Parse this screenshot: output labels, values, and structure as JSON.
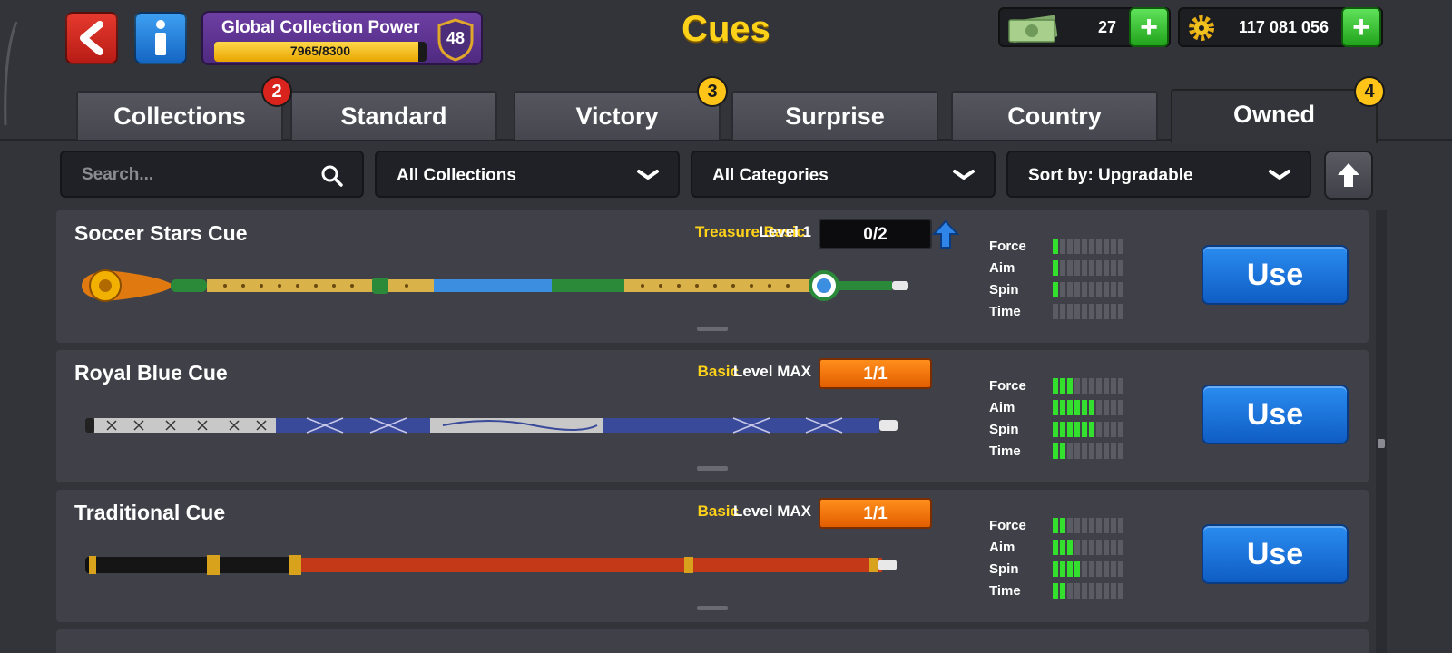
{
  "header": {
    "title": "Cues",
    "back_icon": "back-arrow-icon",
    "info_icon": "info-icon",
    "collection_power": {
      "label": "Global Collection Power",
      "progress_text": "7965/8300",
      "current": 7965,
      "max": 8300,
      "level": "48"
    },
    "cash": {
      "value": "27",
      "icon": "cash-icon"
    },
    "coins": {
      "value": "117 081 056",
      "icon": "coins-gear-icon"
    }
  },
  "tabs": [
    {
      "label": "Collections",
      "badge": "2",
      "badge_color": "#d8241d"
    },
    {
      "label": "Standard",
      "badge": ""
    },
    {
      "label": "Victory",
      "badge": "3",
      "badge_color": "#ffc417"
    },
    {
      "label": "Surprise",
      "badge": ""
    },
    {
      "label": "Country",
      "badge": ""
    },
    {
      "label": "Owned",
      "badge": "4",
      "badge_color": "#ffc417",
      "active": true
    }
  ],
  "filters": {
    "search_placeholder": "Search...",
    "collection": "All Collections",
    "category": "All Categories",
    "sort": "Sort by: Upgradable"
  },
  "stat_labels": [
    "Force",
    "Aim",
    "Spin",
    "Time"
  ],
  "cues": [
    {
      "name": "Soccer Stars Cue",
      "category": "Treasure Basic",
      "level": "Level 1",
      "progress": "0/2",
      "progress_style": "dark",
      "upgradable": true,
      "stats": {
        "force": 1,
        "aim": 1,
        "spin": 1,
        "time": 0
      },
      "use_label": "Use"
    },
    {
      "name": "Royal Blue Cue",
      "category": "Basic",
      "level": "Level MAX",
      "progress": "1/1",
      "progress_style": "orange",
      "upgradable": false,
      "stats": {
        "force": 3,
        "aim": 6,
        "spin": 6,
        "time": 2
      },
      "use_label": "Use"
    },
    {
      "name": "Traditional Cue",
      "category": "Basic",
      "level": "Level MAX",
      "progress": "1/1",
      "progress_style": "orange",
      "upgradable": false,
      "stats": {
        "force": 2,
        "aim": 3,
        "spin": 4,
        "time": 2
      },
      "use_label": "Use"
    }
  ],
  "stat_max_segments": 10,
  "colors": {
    "accent_yellow": "#ffd21a",
    "use_button": "#1a74dc",
    "stat_on": "#33e02e",
    "stat_off": "#5b5c63",
    "background": "#33343a",
    "row": "#404148"
  }
}
